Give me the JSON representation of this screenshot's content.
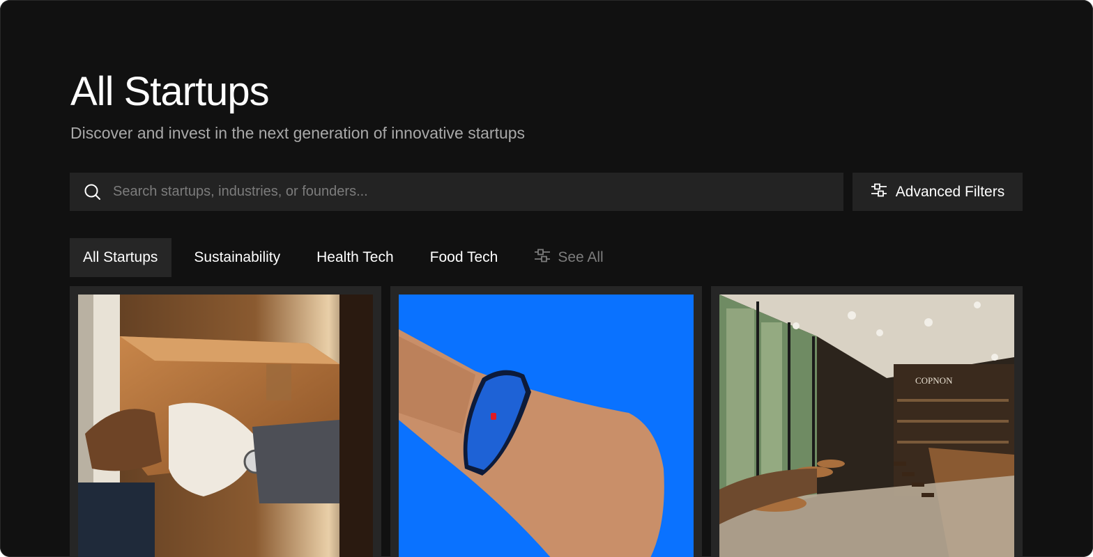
{
  "page": {
    "title": "All Startups",
    "subtitle": "Discover and invest in the next generation of innovative startups"
  },
  "search": {
    "placeholder": "Search startups, industries, or founders...",
    "value": "",
    "icon": "search-icon"
  },
  "filters": {
    "advanced_label": "Advanced Filters",
    "icon": "sliders-icon"
  },
  "tabs": [
    {
      "label": "All Startups",
      "active": true
    },
    {
      "label": "Sustainability",
      "active": false
    },
    {
      "label": "Health Tech",
      "active": false
    },
    {
      "label": "Food Tech",
      "active": false
    }
  ],
  "see_all": {
    "label": "See All",
    "icon": "sliders-icon"
  },
  "cards": [
    {
      "image": "package-delivery-photo"
    },
    {
      "image": "fitness-band-photo"
    },
    {
      "image": "cafe-interior-photo",
      "sign_text": "COPNON"
    }
  ],
  "colors": {
    "background": "#111111",
    "surface": "#232323",
    "text": "#ffffff",
    "muted": "#a9a9a9",
    "accent_blue": "#0a72ff"
  }
}
